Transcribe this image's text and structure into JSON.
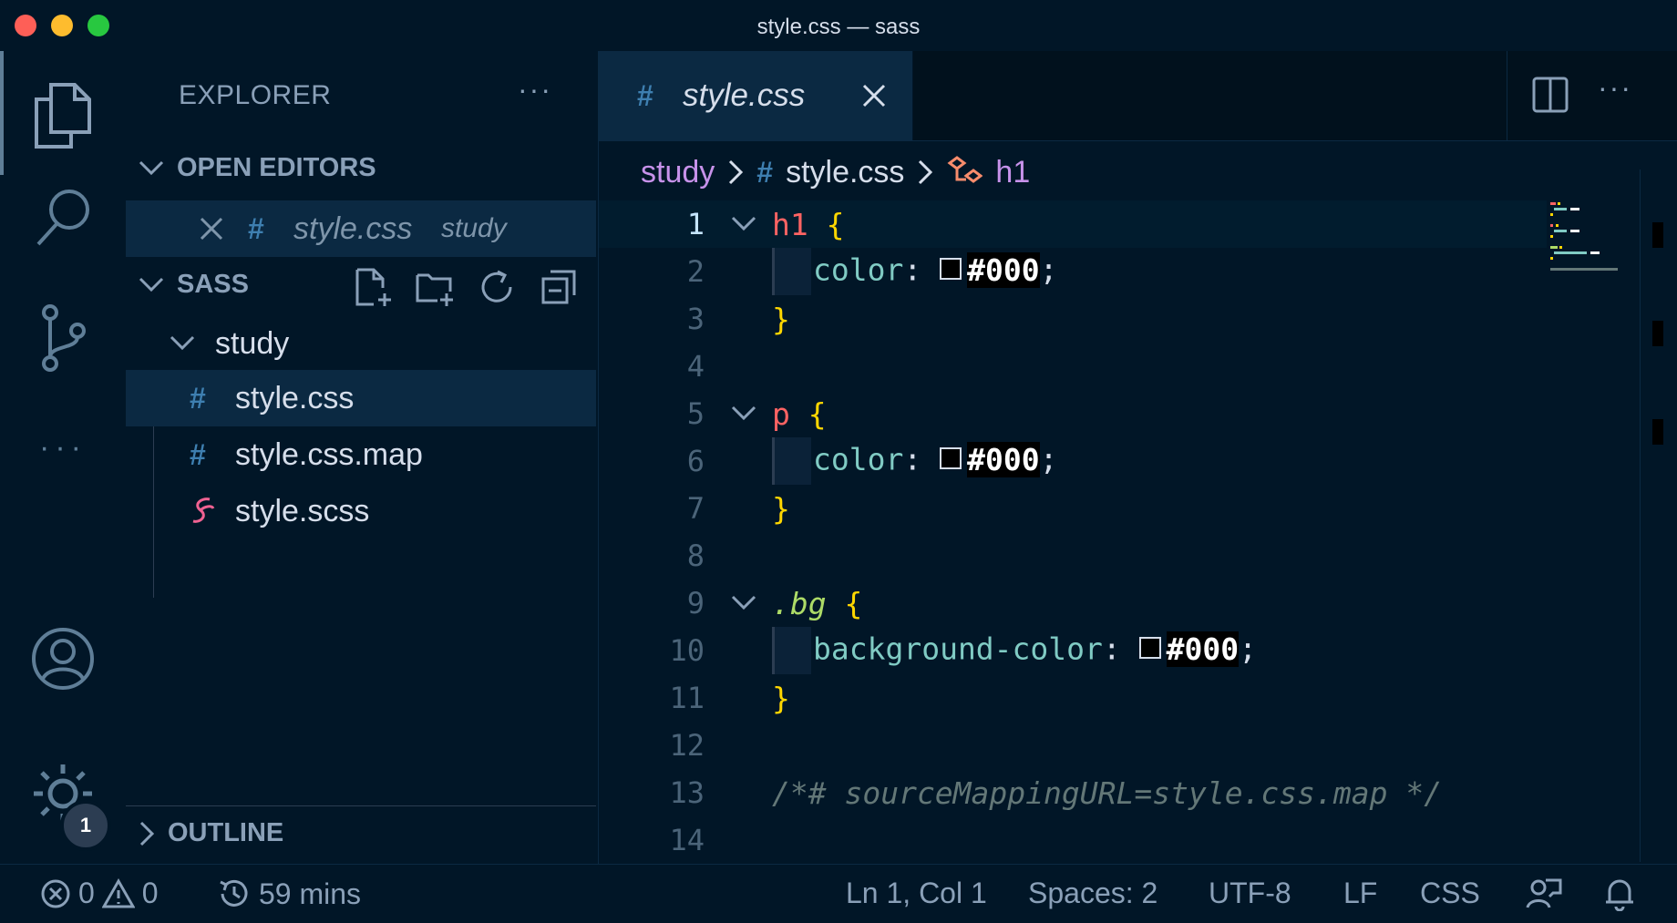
{
  "window": {
    "title": "style.css — sass"
  },
  "sidebar": {
    "header": "EXPLORER",
    "more": "···",
    "open_editors": {
      "label": "OPEN EDITORS",
      "items": [
        {
          "name": "style.css",
          "folder": "study"
        }
      ]
    },
    "workspace": {
      "label": "SASS",
      "folder": "study",
      "files": [
        {
          "name": "style.css",
          "icon": "hash-icon"
        },
        {
          "name": "style.css.map",
          "icon": "hash-icon"
        },
        {
          "name": "style.scss",
          "icon": "sass-icon"
        }
      ]
    },
    "outline": {
      "label": "OUTLINE"
    }
  },
  "activity": {
    "badge": "1"
  },
  "editor": {
    "tab": {
      "name": "style.css"
    },
    "breadcrumb": {
      "folder": "study",
      "file": "style.css",
      "symbol": "h1"
    },
    "lines": [
      "1",
      "2",
      "3",
      "4",
      "5",
      "6",
      "7",
      "8",
      "9",
      "10",
      "11",
      "12",
      "13",
      "14"
    ],
    "code": {
      "l1_sel": "h1",
      "l1_brace": "{",
      "l2_prop": "color",
      "l2_punct": ":",
      "l2_val": "#000",
      "l2_semi": ";",
      "l3_brace": "}",
      "l5_sel": "p",
      "l5_brace": "{",
      "l6_prop": "color",
      "l6_punct": ":",
      "l6_val": "#000",
      "l6_semi": ";",
      "l7_brace": "}",
      "l9_sel": ".bg",
      "l9_brace": "{",
      "l10_prop": "background-color",
      "l10_punct": ":",
      "l10_val": "#000",
      "l10_semi": ";",
      "l11_brace": "}",
      "l13_comment": "/*# sourceMappingURL=style.css.map */"
    }
  },
  "status": {
    "errors": "0",
    "warnings": "0",
    "time": "59 mins",
    "position": "Ln 1, Col 1",
    "spaces": "Spaces: 2",
    "encoding": "UTF-8",
    "eol": "LF",
    "language": "CSS"
  },
  "colors": {
    "background": "#011627",
    "accent": "#0b2942"
  }
}
